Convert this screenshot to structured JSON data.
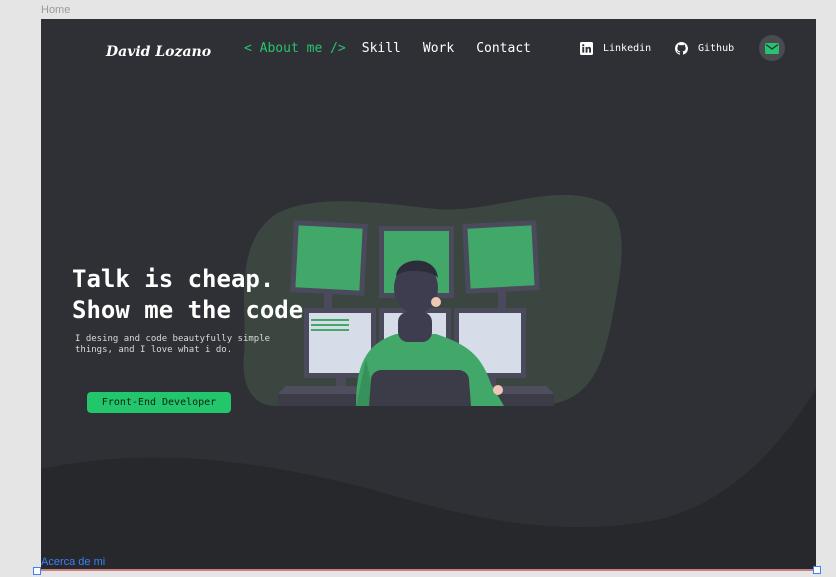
{
  "frames": {
    "home_label": "Home",
    "about_label": "Acerca de mi"
  },
  "header": {
    "logo": "David Lozano",
    "nav": [
      {
        "label": "< About me />",
        "active": true
      },
      {
        "label": "Skill",
        "active": false
      },
      {
        "label": "Work",
        "active": false
      },
      {
        "label": "Contact",
        "active": false
      }
    ],
    "social": {
      "linkedin": "Linkedin",
      "github": "Github"
    },
    "mail_icon": "mail-icon"
  },
  "hero": {
    "title_line1": "Talk is cheap.",
    "title_line2": "Show me the code",
    "subtitle": "I desing and code beautyfully simple things, and I love what i do.",
    "cta": "Front-End Developer"
  },
  "colors": {
    "accent": "#27c46f",
    "background": "#2f3035",
    "blob": "#3a463f"
  }
}
